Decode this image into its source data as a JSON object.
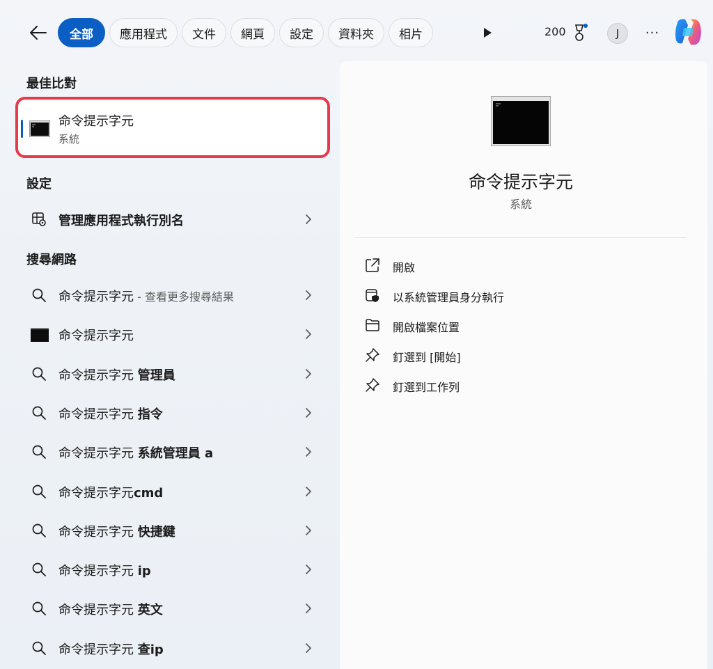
{
  "topbar": {
    "tabs": [
      {
        "label": "全部",
        "active": true
      },
      {
        "label": "應用程式"
      },
      {
        "label": "文件"
      },
      {
        "label": "網頁"
      },
      {
        "label": "設定"
      },
      {
        "label": "資料夾"
      },
      {
        "label": "相片"
      }
    ],
    "points": "200",
    "avatar_initial": "J",
    "more_label": "···"
  },
  "left": {
    "best_match_title": "最佳比對",
    "best_match": {
      "title": "命令提示字元",
      "subtitle": "系統"
    },
    "settings_title": "設定",
    "settings_item": "管理應用程式執行別名",
    "web_title": "搜尋網路",
    "web_items": [
      {
        "base": "命令提示字元",
        "bold": "",
        "muted": " - 查看更多搜尋結果",
        "icon": "search-icon"
      },
      {
        "base": "命令提示字元",
        "bold": "",
        "muted": "",
        "icon": "cmd-icon"
      },
      {
        "base": "命令提示字元 ",
        "bold": "管理員",
        "muted": "",
        "icon": "search-icon"
      },
      {
        "base": "命令提示字元 ",
        "bold": "指令",
        "muted": "",
        "icon": "search-icon"
      },
      {
        "base": "命令提示字元 ",
        "bold": "系統管理員 a",
        "muted": "",
        "icon": "search-icon"
      },
      {
        "base": "命令提示字元",
        "bold": "cmd",
        "muted": "",
        "icon": "search-icon"
      },
      {
        "base": "命令提示字元 ",
        "bold": "快捷鍵",
        "muted": "",
        "icon": "search-icon"
      },
      {
        "base": "命令提示字元 ",
        "bold": "ip",
        "muted": "",
        "icon": "search-icon"
      },
      {
        "base": "命令提示字元 ",
        "bold": "英文",
        "muted": "",
        "icon": "search-icon"
      },
      {
        "base": "命令提示字元 ",
        "bold": "查ip",
        "muted": "",
        "icon": "search-icon"
      }
    ]
  },
  "right": {
    "app_title": "命令提示字元",
    "app_subtitle": "系統",
    "actions": [
      {
        "label": "開啟",
        "icon": "open-external-icon"
      },
      {
        "label": "以系統管理員身分執行",
        "icon": "shield-icon"
      },
      {
        "label": "開啟檔案位置",
        "icon": "folder-icon"
      },
      {
        "label": "釘選到 [開始]",
        "icon": "pin-icon"
      },
      {
        "label": "釘選到工作列",
        "icon": "pin-icon"
      }
    ]
  },
  "colors": {
    "accent": "#0a5ec4",
    "highlight": "#e6394a"
  }
}
